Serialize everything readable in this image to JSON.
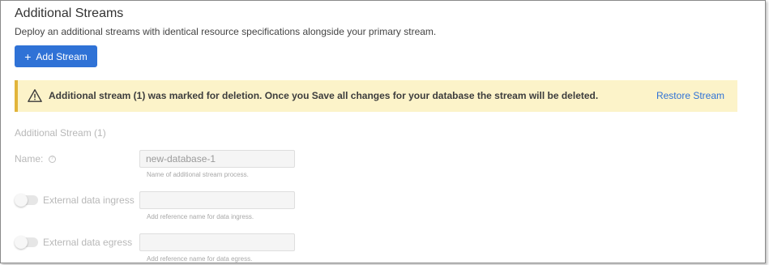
{
  "header": {
    "title": "Additional Streams",
    "subtitle": "Deploy an additional streams with identical resource specifications alongside your primary stream."
  },
  "add_button": {
    "icon": "plus-icon",
    "label": "Add Stream"
  },
  "banner": {
    "icon": "warning-icon",
    "message": "Additional stream (1) was marked for deletion. Once you Save all changes for your database the stream will be deleted.",
    "action": "Restore Stream",
    "colors": {
      "background": "#fcf3c9",
      "accent": "#e2b43a",
      "link": "#2f72d6"
    }
  },
  "stream": {
    "heading": "Additional Stream (1)",
    "name_label": "Name:",
    "name_info_icon": "info-icon",
    "name_value": "new-database-1",
    "name_hint": "Name of additional stream process.",
    "ingress_label": "External data ingress",
    "ingress_value": "",
    "ingress_hint": "Add reference name for data ingress.",
    "ingress_enabled": false,
    "egress_label": "External data egress",
    "egress_value": "",
    "egress_hint": "Add reference name for data egress.",
    "egress_enabled": false
  },
  "colors": {
    "primary": "#2f72d6",
    "muted_text": "#b8b8b8"
  }
}
